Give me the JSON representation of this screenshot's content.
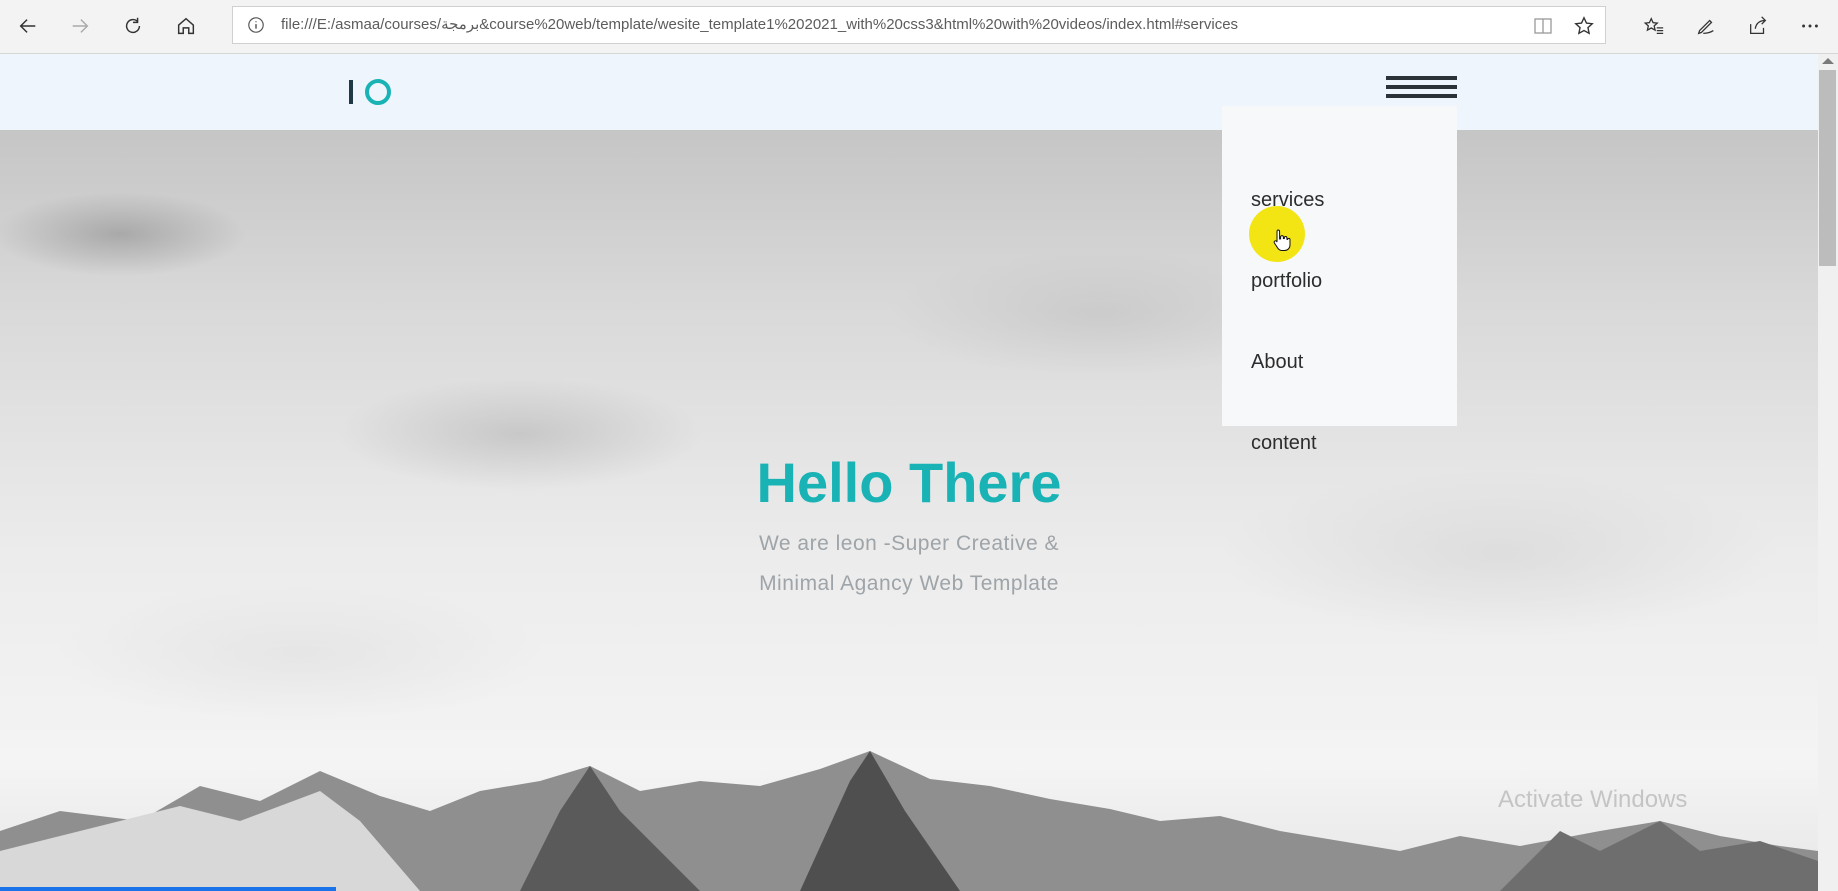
{
  "browser": {
    "url": "file:///E:/asmaa/courses/برمجة&course%20web/template/wesite_template1%202021_with%20css3&html%20with%20videos/index.html#services",
    "icons": [
      "back-icon",
      "forward-icon",
      "refresh-icon",
      "home-icon",
      "info-icon",
      "reading-view-icon",
      "favorite-star-icon",
      "favorites-list-icon",
      "notes-pen-icon",
      "share-icon",
      "more-icon"
    ]
  },
  "site": {
    "logo": "IO",
    "menu": {
      "items": [
        {
          "label": "services"
        },
        {
          "label": "portfolio"
        },
        {
          "label": "About"
        },
        {
          "label": "content"
        }
      ]
    },
    "hero": {
      "title": "Hello There",
      "tagline_line1": "We are leon -Super Creative &",
      "tagline_line2": "Minimal Agancy Web Template"
    }
  },
  "colors": {
    "accent": "#19b3b6",
    "logo_dark": "#1f3a44",
    "navbar_bg": "#eef5fc",
    "cursor_highlight": "#f2e300"
  },
  "system": {
    "watermark": "Activate Windows"
  }
}
